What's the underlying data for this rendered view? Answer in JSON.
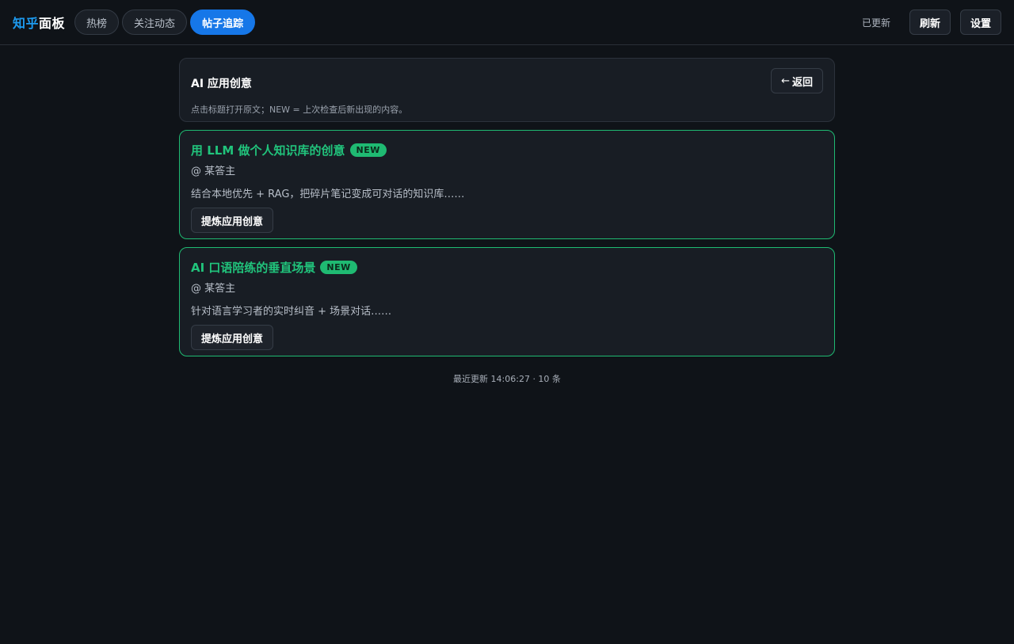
{
  "brand": {
    "part1": "知乎",
    "part2": "面板"
  },
  "nav": {
    "tabs": [
      {
        "label": "热榜",
        "active": false
      },
      {
        "label": "关注动态",
        "active": false
      },
      {
        "label": "帖子追踪",
        "active": true
      }
    ]
  },
  "topbar": {
    "status": "已更新",
    "refresh_label": "刷新",
    "settings_label": "设置"
  },
  "header": {
    "title": "AI 应用创意",
    "hint": "点击标题打开原文；NEW = 上次检查后新出现的内容。",
    "back_arrow": "←",
    "back_label": "返回"
  },
  "posts": [
    {
      "title": "用 LLM 做个人知识库的创意",
      "badge": "NEW",
      "author": "@ 某答主",
      "excerpt": "结合本地优先 + RAG，把碎片笔记变成可对话的知识库……",
      "action_label": "提炼应用创意"
    },
    {
      "title": "AI 口语陪练的垂直场景",
      "badge": "NEW",
      "author": "@ 某答主",
      "excerpt": "针对语言学习者的实时纠音 + 场景对话……",
      "action_label": "提炼应用创意"
    }
  ],
  "footer": {
    "text": "最近更新 14:06:27 · 10 条"
  },
  "colors": {
    "accent": "#1677e8",
    "new": "#1fba72",
    "background": "#0f1318"
  }
}
